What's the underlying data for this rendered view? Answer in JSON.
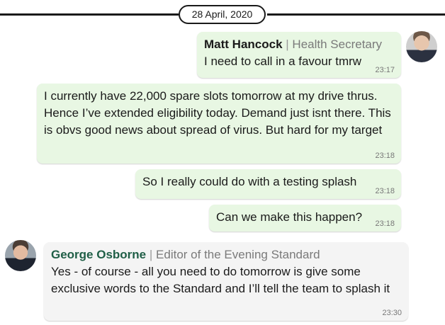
{
  "date_separator": "28 April, 2020",
  "messages": [
    {
      "sender": "Matt Hancock",
      "separator": "|",
      "role": "Health Secretary",
      "text": "I need to call in a favour tmrw",
      "time": "23:17"
    },
    {
      "text": "I currently have 22,000 spare slots tomorrow at my drive thrus. Hence I’ve extended eligibility today. Demand just isnt there. This is obvs good news about spread of virus. But hard for my target",
      "time": "23:18"
    },
    {
      "text": "So I really could do with a testing splash",
      "time": "23:18"
    },
    {
      "text": "Can we make this happen?",
      "time": "23:18"
    },
    {
      "sender": "George Osborne",
      "separator": "|",
      "role": "Editor of the Evening Standard",
      "text": "Yes - of course - all you need to do tomorrow is give some exclusive words to the Standard and I’ll tell the team to splash it",
      "time": "23:30"
    }
  ],
  "colors": {
    "outgoing_bubble": "#e8f7e3",
    "incoming_bubble": "#f4f4f4",
    "hancock_name": "#1a1a1a",
    "osborne_name": "#1f5e46"
  }
}
